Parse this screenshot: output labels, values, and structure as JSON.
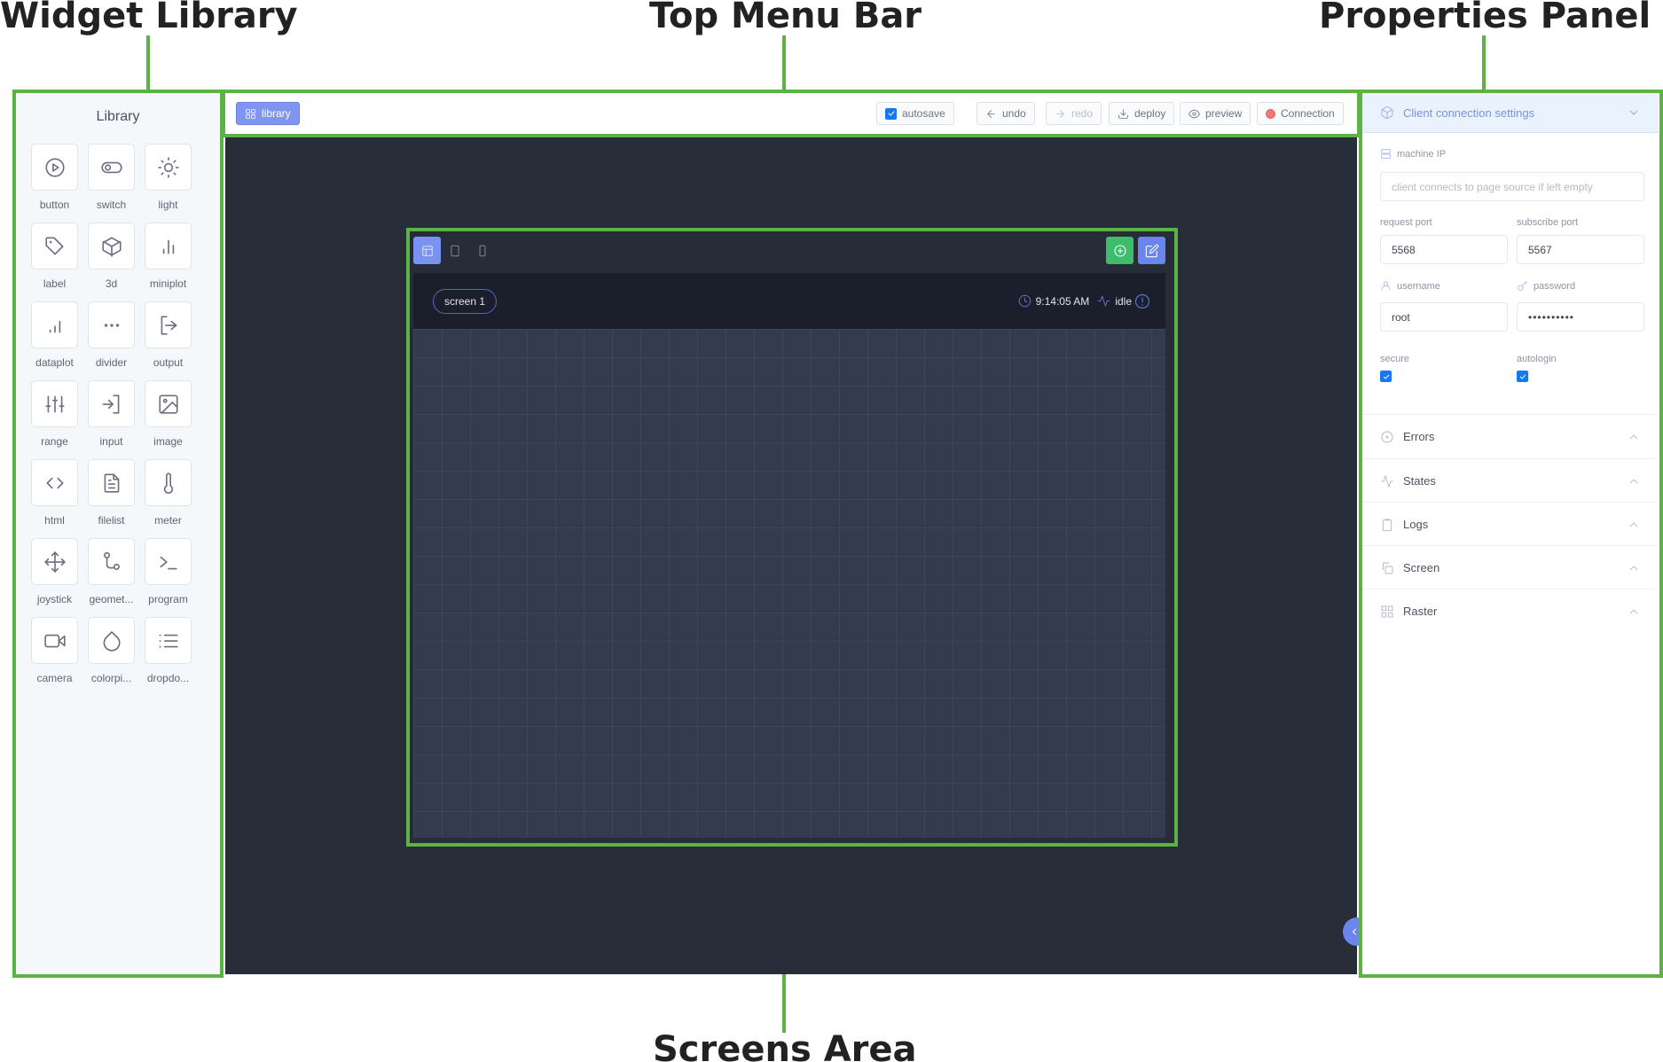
{
  "annotations": {
    "widget_library": "Widget Library",
    "top_menu_bar": "Top Menu Bar",
    "properties_panel": "Properties Panel",
    "screens_area": "Screens Area"
  },
  "library": {
    "title": "Library",
    "widgets": [
      {
        "label": "button",
        "icon": "play-circle-icon"
      },
      {
        "label": "switch",
        "icon": "toggle-icon"
      },
      {
        "label": "light",
        "icon": "sun-icon"
      },
      {
        "label": "label",
        "icon": "tag-icon"
      },
      {
        "label": "3d",
        "icon": "cube-icon"
      },
      {
        "label": "miniplot",
        "icon": "bar-chart-icon"
      },
      {
        "label": "dataplot",
        "icon": "signal-bars-icon"
      },
      {
        "label": "divider",
        "icon": "dots-icon"
      },
      {
        "label": "output",
        "icon": "logout-icon"
      },
      {
        "label": "range",
        "icon": "sliders-icon"
      },
      {
        "label": "input",
        "icon": "login-icon"
      },
      {
        "label": "image",
        "icon": "image-icon"
      },
      {
        "label": "html",
        "icon": "code-icon"
      },
      {
        "label": "filelist",
        "icon": "file-text-icon"
      },
      {
        "label": "meter",
        "icon": "thermometer-icon"
      },
      {
        "label": "joystick",
        "icon": "move-icon"
      },
      {
        "label": "geomet...",
        "icon": "route-icon"
      },
      {
        "label": "program",
        "icon": "terminal-icon"
      },
      {
        "label": "camera",
        "icon": "video-icon"
      },
      {
        "label": "colorpi...",
        "icon": "droplet-icon"
      },
      {
        "label": "dropdo...",
        "icon": "list-icon"
      }
    ]
  },
  "topbar": {
    "library_label": "library",
    "autosave_label": "autosave",
    "autosave_checked": true,
    "undo_label": "undo",
    "redo_label": "redo",
    "deploy_label": "deploy",
    "preview_label": "preview",
    "connection_label": "Connection",
    "connection_status_color": "#f07878"
  },
  "screen": {
    "tab_label": "screen 1",
    "time": "9:14:05 AM",
    "state": "idle"
  },
  "properties": {
    "header": "Client connection settings",
    "machine_ip_label": "machine IP",
    "machine_ip_value": "",
    "machine_ip_placeholder": "client connects to page source if left empty",
    "request_port_label": "request port",
    "request_port_value": "5568",
    "subscribe_port_label": "subscribe port",
    "subscribe_port_value": "5567",
    "username_label": "username",
    "username_value": "root",
    "password_label": "password",
    "password_value": "••••••••••",
    "secure_label": "secure",
    "secure_checked": true,
    "autologin_label": "autologin",
    "autologin_checked": true,
    "sections": [
      {
        "label": "Errors",
        "icon": "x-circle-icon"
      },
      {
        "label": "States",
        "icon": "activity-icon"
      },
      {
        "label": "Logs",
        "icon": "clipboard-icon"
      },
      {
        "label": "Screen",
        "icon": "copy-icon"
      },
      {
        "label": "Raster",
        "icon": "grid-icon"
      }
    ]
  }
}
